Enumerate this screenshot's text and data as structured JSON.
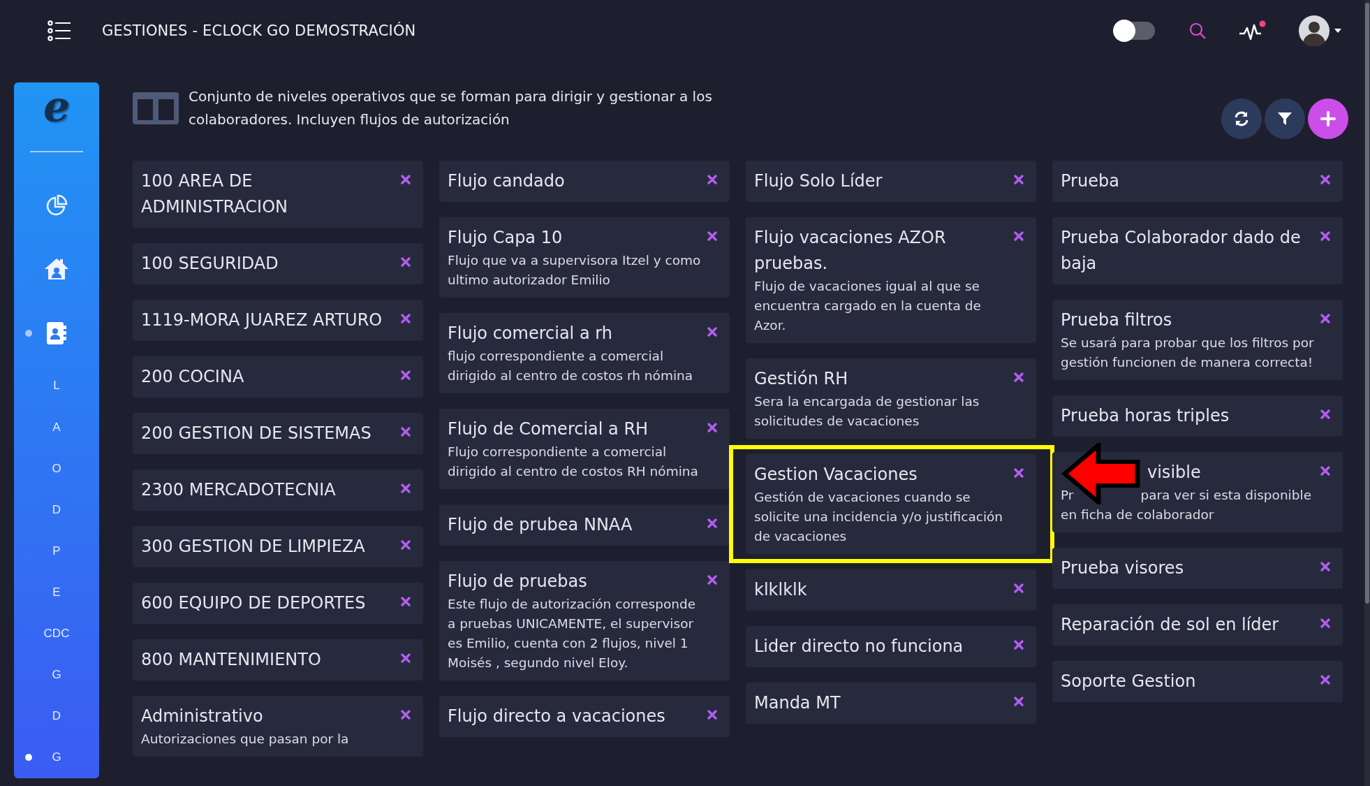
{
  "header": {
    "title": "GESTIONES - ECLOCK GO DEMOSTRACIÓN",
    "toggle": {
      "on": false
    },
    "activity_alert": true
  },
  "sidebar": {
    "logo": "e",
    "items": [
      {
        "kind": "chart",
        "selected": false
      },
      {
        "kind": "home",
        "selected": false
      },
      {
        "kind": "contacts",
        "selected": true
      },
      {
        "kind": "letter",
        "label": "L",
        "selected": false
      },
      {
        "kind": "letter",
        "label": "A",
        "selected": false
      },
      {
        "kind": "letter",
        "label": "O",
        "selected": false
      },
      {
        "kind": "letter",
        "label": "D",
        "selected": false
      },
      {
        "kind": "letter",
        "label": "P",
        "selected": false
      },
      {
        "kind": "letter",
        "label": "E",
        "selected": false
      },
      {
        "kind": "letter",
        "label": "CDC",
        "selected": false
      },
      {
        "kind": "letter",
        "label": "G",
        "selected": false
      },
      {
        "kind": "letter",
        "label": "D",
        "selected": false
      },
      {
        "kind": "letter",
        "label": "G",
        "selected": true
      }
    ]
  },
  "intro": "Conjunto de niveles operativos que se forman para dirigir y gestionar a los colaboradores. Incluyen flujos de autorización",
  "actions": [
    {
      "kind": "refresh"
    },
    {
      "kind": "filter"
    },
    {
      "kind": "add"
    }
  ],
  "columns": [
    {
      "cards": [
        {
          "title": "100 AREA DE ADMINISTRACION"
        },
        {
          "title": "100 SEGURIDAD"
        },
        {
          "title": "1119-MORA JUAREZ ARTURO"
        },
        {
          "title": "200 COCINA"
        },
        {
          "title": "200 GESTION DE SISTEMAS"
        },
        {
          "title": "2300 MERCADOTECNIA"
        },
        {
          "title": "300 GESTION DE LIMPIEZA"
        },
        {
          "title": "600 EQUIPO DE DEPORTES"
        },
        {
          "title": "800 MANTENIMIENTO"
        },
        {
          "title": "Administrativo",
          "description": "Autorizaciones que pasan por la"
        }
      ]
    },
    {
      "cards": [
        {
          "title": "Flujo candado"
        },
        {
          "title": "Flujo Capa 10",
          "description": "Flujo que va a supervisora Itzel y como ultimo autorizador Emilio"
        },
        {
          "title": "Flujo comercial a rh",
          "description": "flujo correspondiente a comercial dirigido al centro de costos rh nómina"
        },
        {
          "title": "Flujo de Comercial a RH",
          "description": "Flujo correspondiente a comercial dirigido al centro de costos RH nómina"
        },
        {
          "title": "Flujo de prubea NNAA"
        },
        {
          "title": "Flujo de pruebas",
          "description": "Este flujo de autorización corresponde a pruebas UNICAMENTE, el supervisor es Emilio, cuenta con 2 flujos, nivel 1 Moisés , segundo nivel Eloy."
        },
        {
          "title": "Flujo directo a vacaciones"
        }
      ]
    },
    {
      "cards": [
        {
          "title": "Flujo Solo Líder"
        },
        {
          "title": "Flujo vacaciones AZOR pruebas.",
          "description": "Flujo de vacaciones igual al que se encuentra cargado en la cuenta de Azor."
        },
        {
          "title": "Gestión RH",
          "description": "Sera la encargada de gestionar las solicitudes de vacaciones"
        },
        {
          "title": "Gestion Vacaciones",
          "description": "Gestión de vacaciones cuando se solicite una incidencia y/o justificación de vacaciones",
          "highlighted": true
        },
        {
          "title": "klklklk"
        },
        {
          "title": "Lider directo no funciona"
        },
        {
          "title": "Manda MT"
        }
      ]
    },
    {
      "cards": [
        {
          "title": "Prueba"
        },
        {
          "title": "Prueba Colaborador dado de baja"
        },
        {
          "title": "Prueba filtros",
          "description": "Se usará para probar que los filtros por gestión funcionen de manera correcta!"
        },
        {
          "title": "Prueba horas triples"
        },
        {
          "title": "visible",
          "description_parts": [
            "Pr",
            "para ver si esta disponible",
            "en ficha de colaborador"
          ],
          "pointer_arrow": true
        },
        {
          "title": "Prueba visores"
        },
        {
          "title": "Reparación de sol en líder"
        },
        {
          "title": "Soporte Gestion"
        }
      ]
    }
  ]
}
